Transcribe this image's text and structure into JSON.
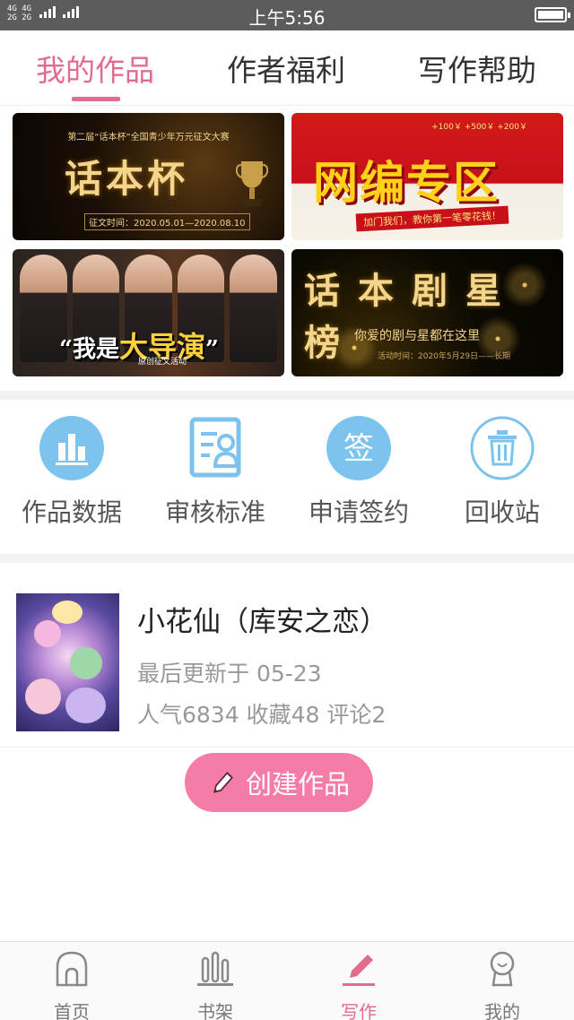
{
  "status_bar": {
    "network_top": "4G",
    "network_top2": "4G",
    "network_bottom": "2G",
    "network_bottom2": "2G",
    "time": "上午5:56",
    "battery_level": 1.0
  },
  "tabs": [
    {
      "label": "我的作品",
      "active": true
    },
    {
      "label": "作者福利",
      "active": false
    },
    {
      "label": "写作帮助",
      "active": false
    }
  ],
  "banners": {
    "b1": {
      "small": "第二届“话本杯”全国青少年万元征文大赛",
      "big": "话本杯",
      "date": "征文时间：2020.05.01—2020.08.10"
    },
    "b2": {
      "big": "网编专区",
      "stamp": "加门我们，教你第一笔零花钱！",
      "coins": "+100￥  +500￥  +200￥"
    },
    "b3": {
      "big_prefix": "“我是",
      "big_bold": "大导演",
      "big_suffix": "”",
      "sub": "原创征文活动"
    },
    "b4": {
      "big": "话本剧星榜",
      "line": "你爱的剧与星都在这里",
      "date": "活动时间：2020年5月29日——长期"
    }
  },
  "actions": [
    {
      "label": "作品数据",
      "icon": "bar-chart-icon"
    },
    {
      "label": "审核标准",
      "icon": "review-doc-icon"
    },
    {
      "label": "申请签约",
      "icon": "sign-contract-icon",
      "glyph": "签"
    },
    {
      "label": "回收站",
      "icon": "trash-icon"
    }
  ],
  "work": {
    "title": "小花仙（库安之恋）",
    "updated": "最后更新于 05-23",
    "stats": "人气6834 收藏48 评论2"
  },
  "create_button": {
    "label": "创建作品",
    "icon": "pencil-icon"
  },
  "bottom_nav": [
    {
      "label": "首页",
      "icon": "home-icon",
      "active": false
    },
    {
      "label": "书架",
      "icon": "bookshelf-icon",
      "active": false
    },
    {
      "label": "写作",
      "icon": "pen-icon",
      "active": true
    },
    {
      "label": "我的",
      "icon": "profile-icon",
      "active": false
    }
  ],
  "colors": {
    "accent": "#e26c8e",
    "create_button": "#f47ca6",
    "icon_blue": "#7cc4ee"
  }
}
